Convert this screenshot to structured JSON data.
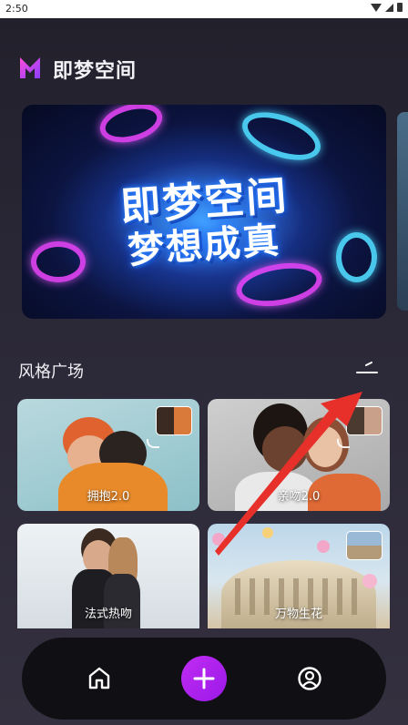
{
  "status_bar": {
    "time": "2:50"
  },
  "header": {
    "app_title": "即梦空间",
    "logo_icon": "m-logo-icon"
  },
  "banner": {
    "line1": "即梦空间",
    "line2": "梦想成真"
  },
  "section": {
    "title": "风格广场",
    "more_icon": "chevron-right-icon"
  },
  "cards": [
    {
      "label": "拥抱2.0"
    },
    {
      "label": "亲吻2.0"
    },
    {
      "label": "法式热吻"
    },
    {
      "label": "万物生花"
    }
  ],
  "nav": {
    "home_icon": "home-icon",
    "add_icon": "plus-icon",
    "profile_icon": "profile-icon"
  },
  "colors": {
    "accent": "#b324ee",
    "background": "#2b2838",
    "annotation": "#e8302a"
  }
}
